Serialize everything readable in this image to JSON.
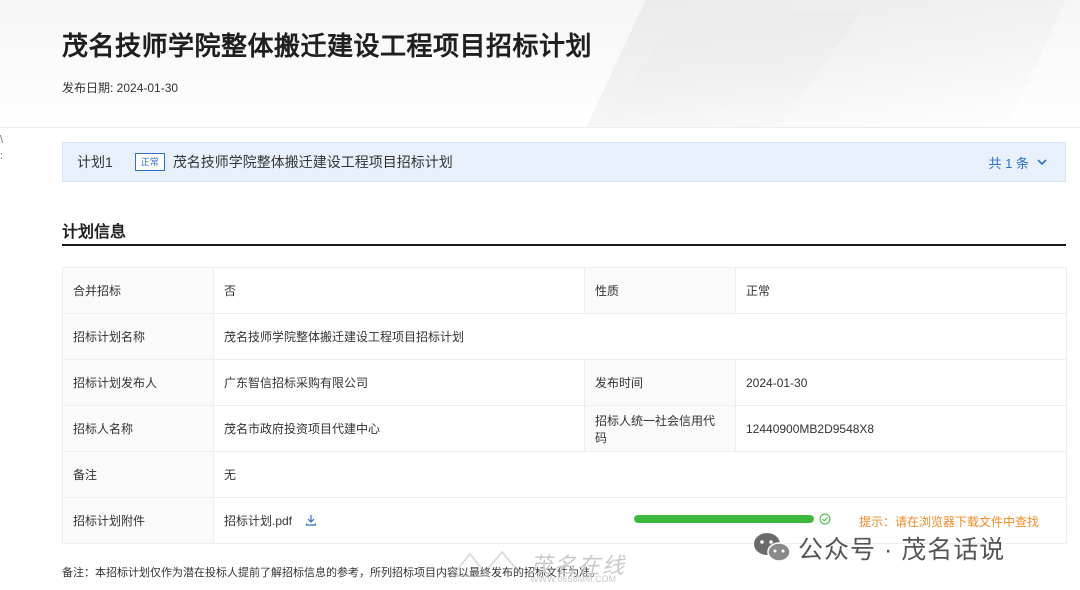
{
  "header": {
    "title": "茂名技师学院整体搬迁建设工程项目招标计划",
    "publish_date": "发布日期: 2024-01-30"
  },
  "side_marks": [
    "\\",
    ":"
  ],
  "plan_bar": {
    "index": "计划1",
    "badge": "正常",
    "name": "茂名技师学院整体搬迁建设工程项目招标计划",
    "count": "共 1 条"
  },
  "section": {
    "title": "计划信息"
  },
  "info": {
    "row1": {
      "l1": "合并招标",
      "v1": "否",
      "l2": "性质",
      "v2": "正常"
    },
    "row2": {
      "l1": "招标计划名称",
      "v1": "茂名技师学院整体搬迁建设工程项目招标计划"
    },
    "row3": {
      "l1": "招标计划发布人",
      "v1": "广东智信招标采购有限公司",
      "l2": "发布时间",
      "v2": "2024-01-30"
    },
    "row4": {
      "l1": "招标人名称",
      "v1": "茂名市政府投资项目代建中心",
      "l2": "招标人统一社会信用代码",
      "v2": "12440900MB2D9548X8"
    },
    "row5": {
      "l1": "备注",
      "v1": "无"
    },
    "row6": {
      "l1": "招标计划附件",
      "file": "招标计划.pdf",
      "progress": 1.0,
      "hint": "提示：请在浏览器下载文件中查找"
    }
  },
  "footnote": "备注：本招标计划仅作为潜在投标人提前了解招标信息的参考，所列招标项目内容以最终发布的招标文件为准。",
  "watermarks": {
    "site_name": "茂名在线",
    "site_url": "WWW.0668MM.COM",
    "wechat": "公众号 · 茂名话说"
  },
  "colors": {
    "accent": "#2f6fd0",
    "plan_bar_bg": "#e8f1fb",
    "progress": "#3cb83c",
    "hint": "#f08a24"
  }
}
